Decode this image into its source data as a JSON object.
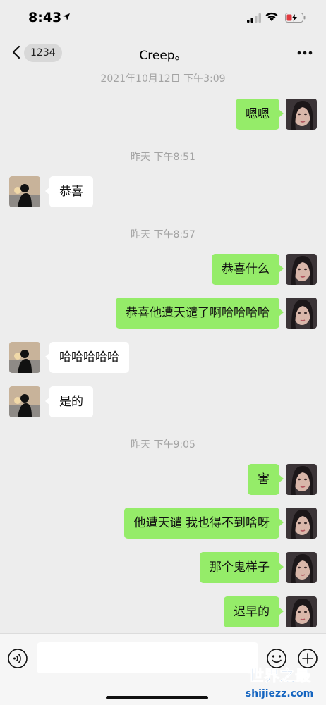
{
  "status_bar": {
    "time": "8:43"
  },
  "nav": {
    "unread_count": "1234",
    "title": "Creep。"
  },
  "timestamps": [
    "2021年10月12日 下午3:09",
    "昨天 下午8:51",
    "昨天 下午8:57",
    "昨天 下午9:05"
  ],
  "messages": [
    {
      "side": "out",
      "text": "嗯嗯"
    },
    {
      "side": "in",
      "text": "恭喜"
    },
    {
      "side": "out",
      "text": "恭喜什么"
    },
    {
      "side": "out",
      "text": "恭喜他遭天谴了啊哈哈哈哈"
    },
    {
      "side": "in",
      "text": "哈哈哈哈哈"
    },
    {
      "side": "in",
      "text": "是的"
    },
    {
      "side": "out",
      "text": "害"
    },
    {
      "side": "out",
      "text": "他遭天谴 我也得不到啥呀"
    },
    {
      "side": "out",
      "text": "那个鬼样子"
    },
    {
      "side": "out",
      "text": "迟早的"
    }
  ],
  "input": {
    "value": ""
  },
  "icons": {
    "back": "chevron-left-icon",
    "more": "more-dots-icon",
    "voice": "voice-icon",
    "emoji": "emoji-icon",
    "plus": "plus-icon"
  },
  "colors": {
    "background": "#ededed",
    "outgoing_bubble": "#95ec69",
    "incoming_bubble": "#ffffff",
    "timestamp_text": "#a3a3a3"
  },
  "watermark": {
    "line1": "世界之最",
    "line2": "shijiezz.com"
  }
}
